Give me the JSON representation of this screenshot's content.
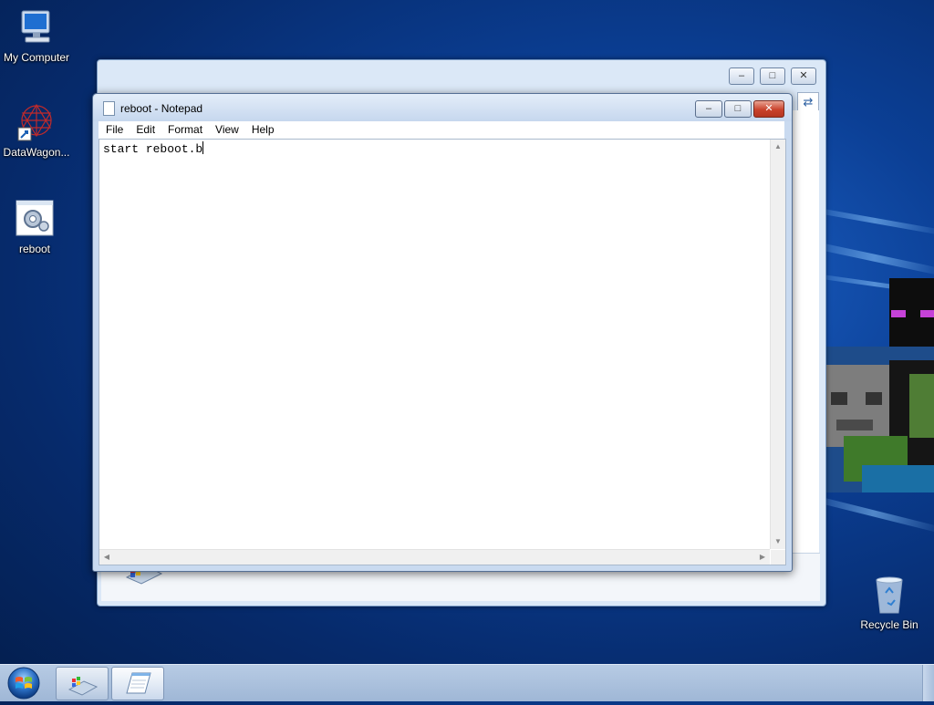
{
  "desktop": {
    "icons": [
      {
        "label": "My Computer",
        "icon": "computer-icon"
      },
      {
        "label": "DataWagon...",
        "icon": "datawagon-shortcut-icon"
      },
      {
        "label": "reboot",
        "icon": "batch-file-gear-icon"
      },
      {
        "label": "Recycle Bin",
        "icon": "recycle-bin-icon"
      }
    ]
  },
  "notepad": {
    "title": "reboot - Notepad",
    "menu": [
      "File",
      "Edit",
      "Format",
      "View",
      "Help"
    ],
    "content": "start reboot.b",
    "buttons": {
      "minimize": "–",
      "maximize": "□",
      "close": "✕"
    }
  },
  "background_window": {
    "buttons": {
      "minimize": "–",
      "maximize": "□",
      "close": "✕"
    }
  },
  "taskbar": {
    "start_icon": "windows-orb-icon",
    "items": [
      {
        "icon": "control-panel-icon",
        "active": false
      },
      {
        "icon": "notepad-icon",
        "active": true
      }
    ]
  },
  "colors": {
    "desktop_bg": "#0b3f95",
    "titlebar": "#c6d7ee",
    "close": "#c9422b",
    "taskbar": "#a9bfdc"
  }
}
